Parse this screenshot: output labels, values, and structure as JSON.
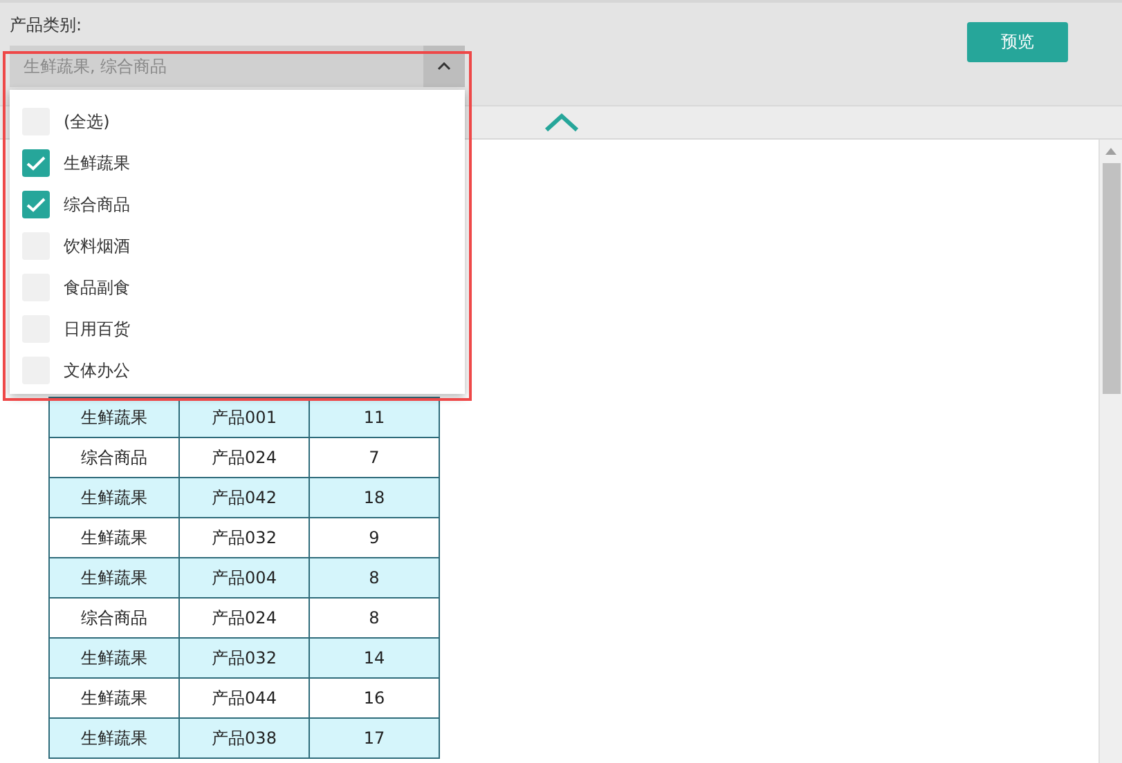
{
  "filter": {
    "label": "产品类别:",
    "value": "生鲜蔬果, 综合商品",
    "expanded": true,
    "options": [
      {
        "label": "(全选)",
        "checked": false
      },
      {
        "label": "生鲜蔬果",
        "checked": true
      },
      {
        "label": "综合商品",
        "checked": true
      },
      {
        "label": "饮料烟酒",
        "checked": false
      },
      {
        "label": "食品副食",
        "checked": false
      },
      {
        "label": "日用百货",
        "checked": false
      },
      {
        "label": "文体办公",
        "checked": false
      }
    ]
  },
  "preview_button": "预览",
  "table": {
    "rows": [
      [
        "生鲜蔬果",
        "产品001",
        "11"
      ],
      [
        "综合商品",
        "产品024",
        "7"
      ],
      [
        "生鲜蔬果",
        "产品042",
        "18"
      ],
      [
        "生鲜蔬果",
        "产品032",
        "9"
      ],
      [
        "生鲜蔬果",
        "产品004",
        "8"
      ],
      [
        "综合商品",
        "产品024",
        "8"
      ],
      [
        "生鲜蔬果",
        "产品032",
        "14"
      ],
      [
        "生鲜蔬果",
        "产品044",
        "16"
      ],
      [
        "生鲜蔬果",
        "产品038",
        "17"
      ]
    ]
  }
}
